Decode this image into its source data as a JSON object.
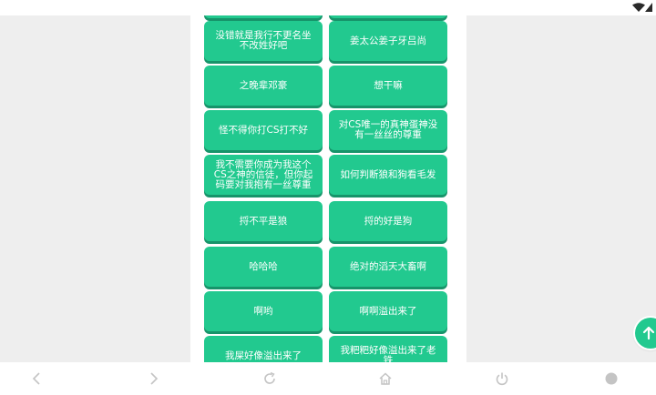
{
  "buttons": [
    {
      "label": ""
    },
    {
      "label": ""
    },
    {
      "label": "没错就是我行不更名坐不改姓好吧"
    },
    {
      "label": "姜太公姜子牙吕尚"
    },
    {
      "label": "之晚辈邓豪"
    },
    {
      "label": "想干嘛"
    },
    {
      "label": "怪不得你打CS打不好"
    },
    {
      "label": "对CS唯一的真神蛋神没有一丝丝的尊重"
    },
    {
      "label": "我不需要你成为我这个CS之神的信徒，但你起码要对我抱有一丝尊重"
    },
    {
      "label": "如何判断狼和狗看毛发"
    },
    {
      "label": "捋不平是狼"
    },
    {
      "label": "捋的好是狗"
    },
    {
      "label": "哈哈哈"
    },
    {
      "label": "绝对的滔天大畜啊"
    },
    {
      "label": "啊哟"
    },
    {
      "label": "啊啊溢出来了"
    },
    {
      "label": "我屎好像溢出来了"
    },
    {
      "label": "我粑粑好像溢出来了老铁"
    }
  ],
  "colors": {
    "button_bg": "#22c98f",
    "button_shadow": "#17946a",
    "page_bg": "#eeeeee",
    "panel_bg": "#ffffff",
    "nav_icon": "#c4c4c4"
  },
  "icons": {
    "status": [
      "wifi-icon",
      "signal-icon"
    ],
    "nav": [
      "back-icon",
      "forward-icon",
      "refresh-icon",
      "home-icon",
      "power-icon",
      "menu-dot-icon"
    ],
    "fab": "arrow-up-icon"
  }
}
